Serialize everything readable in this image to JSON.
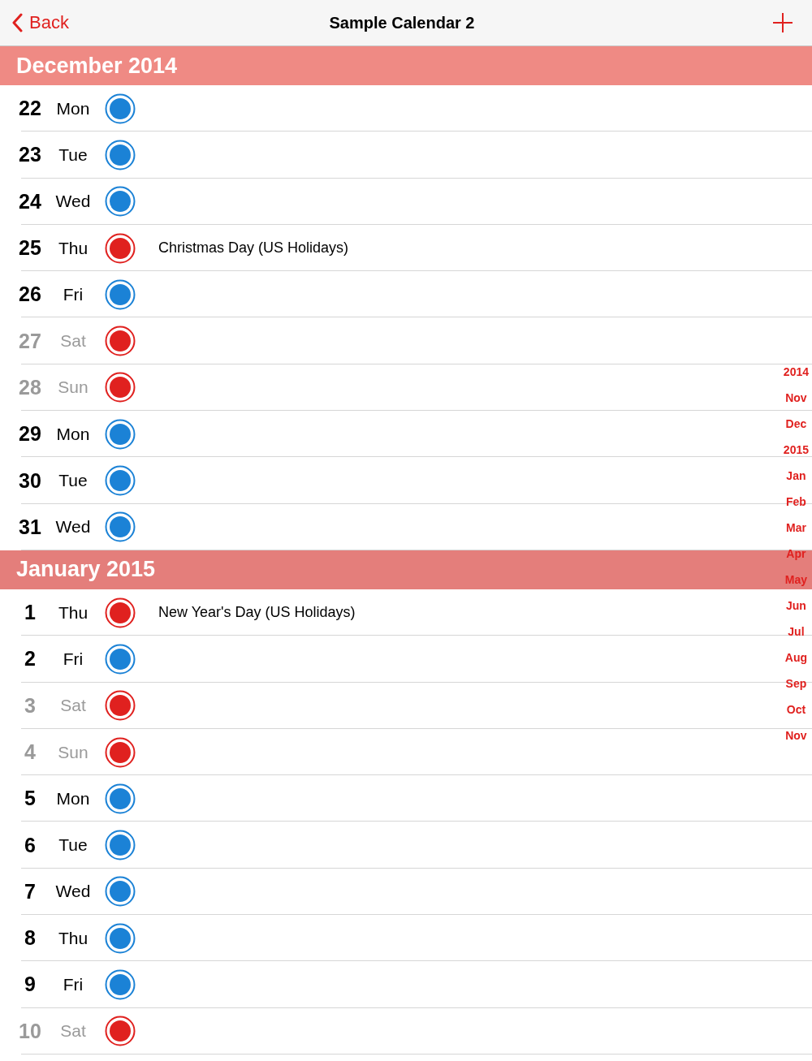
{
  "nav": {
    "back_label": "Back",
    "title": "Sample Calendar 2"
  },
  "sections": [
    {
      "title": "December 2014",
      "pinned": true,
      "rows": [
        {
          "day": "22",
          "weekday": "Mon",
          "weekend": false,
          "color": "#1b82d6"
        },
        {
          "day": "23",
          "weekday": "Tue",
          "weekend": false,
          "color": "#1b82d6"
        },
        {
          "day": "24",
          "weekday": "Wed",
          "weekend": false,
          "color": "#1b82d6"
        },
        {
          "day": "25",
          "weekday": "Thu",
          "weekend": false,
          "color": "#e0211f",
          "event": "Christmas Day (US Holidays)"
        },
        {
          "day": "26",
          "weekday": "Fri",
          "weekend": false,
          "color": "#1b82d6"
        },
        {
          "day": "27",
          "weekday": "Sat",
          "weekend": true,
          "color": "#e0211f"
        },
        {
          "day": "28",
          "weekday": "Sun",
          "weekend": true,
          "color": "#e0211f"
        },
        {
          "day": "29",
          "weekday": "Mon",
          "weekend": false,
          "color": "#1b82d6"
        },
        {
          "day": "30",
          "weekday": "Tue",
          "weekend": false,
          "color": "#1b82d6"
        },
        {
          "day": "31",
          "weekday": "Wed",
          "weekend": false,
          "color": "#1b82d6"
        }
      ]
    },
    {
      "title": "January 2015",
      "pinned": false,
      "rows": [
        {
          "day": "1",
          "weekday": "Thu",
          "weekend": false,
          "color": "#e0211f",
          "event": "New Year's Day (US Holidays)"
        },
        {
          "day": "2",
          "weekday": "Fri",
          "weekend": false,
          "color": "#1b82d6"
        },
        {
          "day": "3",
          "weekday": "Sat",
          "weekend": true,
          "color": "#e0211f"
        },
        {
          "day": "4",
          "weekday": "Sun",
          "weekend": true,
          "color": "#e0211f"
        },
        {
          "day": "5",
          "weekday": "Mon",
          "weekend": false,
          "color": "#1b82d6"
        },
        {
          "day": "6",
          "weekday": "Tue",
          "weekend": false,
          "color": "#1b82d6"
        },
        {
          "day": "7",
          "weekday": "Wed",
          "weekend": false,
          "color": "#1b82d6"
        },
        {
          "day": "8",
          "weekday": "Thu",
          "weekend": false,
          "color": "#1b82d6"
        },
        {
          "day": "9",
          "weekday": "Fri",
          "weekend": false,
          "color": "#1b82d6"
        },
        {
          "day": "10",
          "weekday": "Sat",
          "weekend": true,
          "color": "#e0211f"
        }
      ]
    }
  ],
  "index": [
    "2014",
    "Nov",
    "Dec",
    "2015",
    "Jan",
    "Feb",
    "Mar",
    "Apr",
    "May",
    "Jun",
    "Jul",
    "Aug",
    "Sep",
    "Oct",
    "Nov"
  ]
}
